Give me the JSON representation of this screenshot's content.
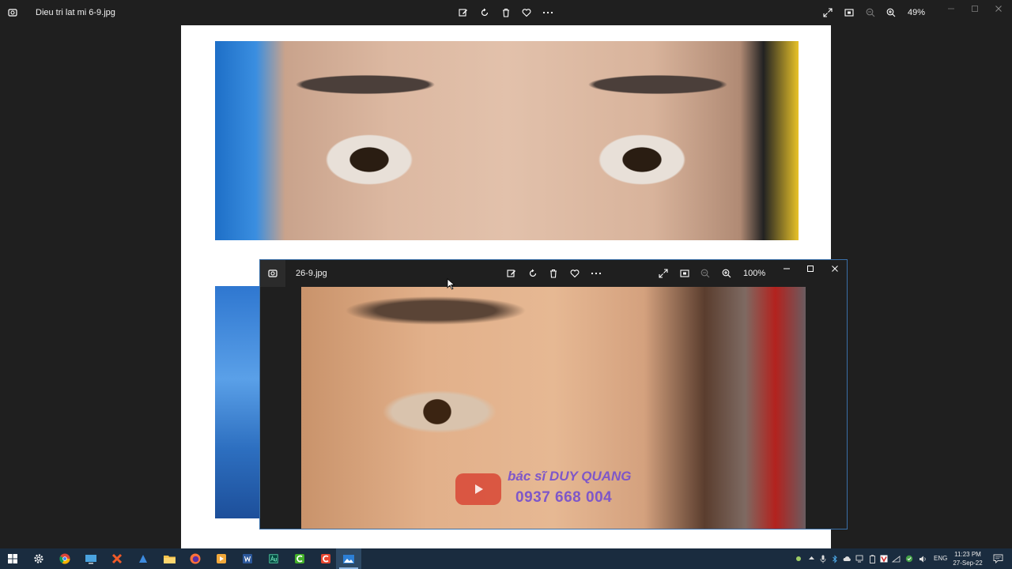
{
  "main_window": {
    "title": "Dieu tri lat mi 6-9.jpg",
    "zoom": "49%",
    "toolbar_icons": [
      "edit-icon",
      "rotate-icon",
      "delete-icon",
      "favorite-icon",
      "more-icon"
    ],
    "right_icons": [
      "fullscreen-icon",
      "fit-icon",
      "zoom-out-icon",
      "zoom-in-icon"
    ]
  },
  "viewer_window": {
    "title": "26-9.jpg",
    "zoom": "100%",
    "watermark": {
      "line1": "bác sĩ DUY QUANG",
      "line2": "0937 668 004"
    }
  },
  "taskbar": {
    "apps": [
      "start",
      "settings",
      "chrome",
      "remote-desktop",
      "xmind",
      "vpn",
      "file-explorer",
      "firefox",
      "media-player",
      "word",
      "audition",
      "camtasia-green",
      "camtasia-red",
      "photos"
    ],
    "active_app": "photos",
    "language": "ENG",
    "time": "11:23 PM",
    "date": "27-Sep-22"
  },
  "colors": {
    "background": "#1f1f1f",
    "taskbar": "#1a2c3f",
    "watermark": "#7e57c9",
    "accent_border": "#3a6fa8"
  }
}
